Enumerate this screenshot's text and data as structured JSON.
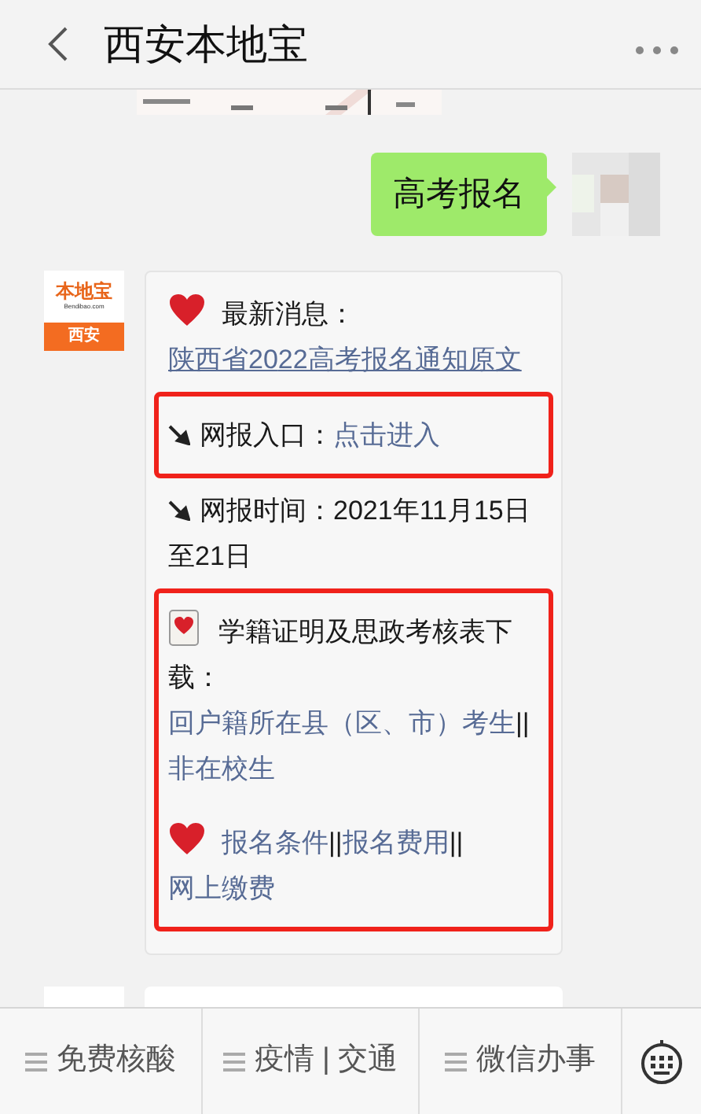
{
  "header": {
    "title": "西安本地宝"
  },
  "sent": {
    "text": "高考报名"
  },
  "sender": {
    "logo_name": "本地宝",
    "logo_domain": "Bendibao.com",
    "logo_city": "西安"
  },
  "blocks": [
    {
      "highlighted": false,
      "paragraphs": [
        {
          "kind": "heart",
          "parts": [
            {
              "kind": "text",
              "text": "最新消息："
            },
            {
              "kind": "underlined_link",
              "text": "陕西省20"
            },
            {
              "kind": "underlined_link",
              "text": "22高考报名通知原文"
            }
          ]
        }
      ]
    },
    {
      "highlighted": true,
      "paragraphs": [
        {
          "kind": "pin",
          "parts": [
            {
              "kind": "text",
              "text": "网报入口："
            },
            {
              "kind": "link",
              "text": "点击进入"
            }
          ]
        }
      ]
    },
    {
      "highlighted": false,
      "paragraphs": [
        {
          "kind": "pin",
          "parts": [
            {
              "kind": "text",
              "text": "网报时间：2021年11月15日至21日"
            }
          ]
        }
      ]
    },
    {
      "highlighted": true,
      "paragraphs": [
        {
          "kind": "card",
          "parts": [
            {
              "kind": "text",
              "text": "学籍证明及思政考核表下载："
            },
            {
              "kind": "link",
              "text": "回户籍所在县（"
            },
            {
              "kind": "link",
              "text": "区、市）考生"
            },
            {
              "kind": "text",
              "text": "||"
            },
            {
              "kind": "link",
              "text": "非在校生"
            }
          ]
        },
        {
          "kind": "heart",
          "parts": [
            {
              "kind": "link",
              "text": "报名条件"
            },
            {
              "kind": "text",
              "text": "||"
            },
            {
              "kind": "link",
              "text": "报名费用"
            },
            {
              "kind": "text",
              "text": "||"
            },
            {
              "kind": "link",
              "text": "网上缴费"
            }
          ]
        }
      ]
    }
  ],
  "menu": [
    {
      "text": "免费核酸"
    },
    {
      "text": "疫情 | 交通"
    },
    {
      "text": "微信办事"
    }
  ]
}
